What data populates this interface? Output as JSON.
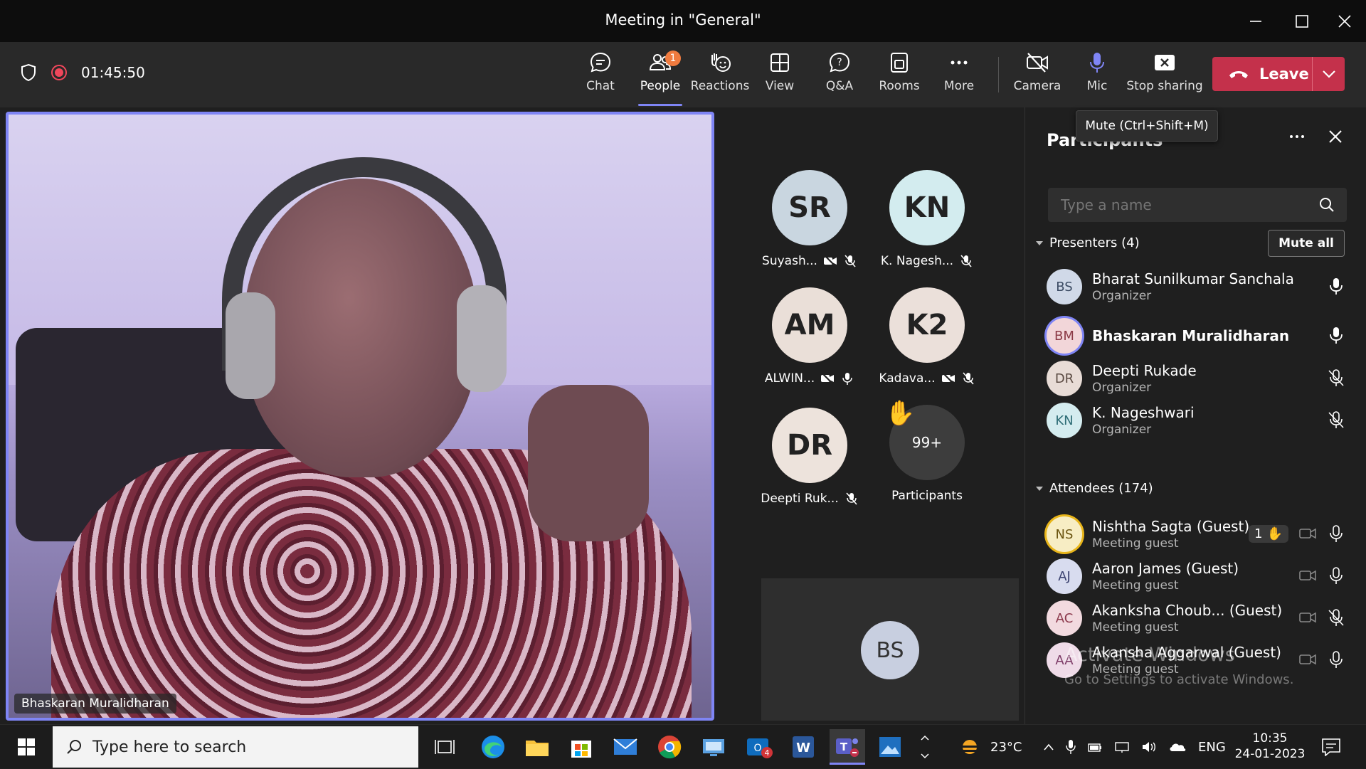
{
  "window": {
    "title": "Meeting in \"General\"",
    "controls": [
      "minimize",
      "maximize",
      "close"
    ]
  },
  "toolbar": {
    "timer": "01:45:50",
    "buttons": [
      {
        "label": "Chat",
        "icon": "chat-icon"
      },
      {
        "label": "People",
        "icon": "people-icon",
        "badge": "1"
      },
      {
        "label": "Reactions",
        "icon": "reactions-icon"
      },
      {
        "label": "View",
        "icon": "view-icon"
      },
      {
        "label": "Q&A",
        "icon": "qa-icon"
      },
      {
        "label": "Rooms",
        "icon": "rooms-icon"
      },
      {
        "label": "More",
        "icon": "more-icon"
      },
      {
        "label": "Camera",
        "icon": "camera-off-icon"
      },
      {
        "label": "Mic",
        "icon": "mic-icon"
      },
      {
        "label": "Stop sharing",
        "icon": "stop-sharing-icon"
      }
    ],
    "leave_label": "Leave",
    "tooltip": "Mute (Ctrl+Shift+M)"
  },
  "stage": {
    "main_video_name": "Bhaskaran Muralidharan",
    "tiles": [
      {
        "initials": "SR",
        "name": "Suyash...",
        "color": "#c9d6e0"
      },
      {
        "initials": "KN",
        "name": "K. Nagesh...",
        "color": "#d3ecef"
      },
      {
        "initials": "AM",
        "name": "ALWIN...",
        "color": "#eadfd8"
      },
      {
        "initials": "K2",
        "name": "Kadava...",
        "color": "#ebe0da"
      },
      {
        "initials": "DR",
        "name": "Deepti Ruk...",
        "color": "#ede3dc"
      }
    ],
    "more": {
      "count": "99+",
      "label": "Participants"
    },
    "share_tile_initials": "BS"
  },
  "panel": {
    "title": "Participants",
    "search_placeholder": "Type a name",
    "presenters_label": "Presenters (4)",
    "mute_all_label": "Mute all",
    "presenters": [
      {
        "initials": "BS",
        "name": "Bharat Sunilkumar Sanchala",
        "role": "Organizer",
        "avatar_bg": "#d0d9e8",
        "avatar_fg": "#3b4b63"
      },
      {
        "initials": "BM",
        "name": "Bhaskaran Muralidharan",
        "role": "",
        "avatar_bg": "#f2d6d9",
        "avatar_fg": "#8b3a46"
      },
      {
        "initials": "DR",
        "name": "Deepti Rukade",
        "role": "Organizer",
        "avatar_bg": "#e8dcd6",
        "avatar_fg": "#5a4a42"
      },
      {
        "initials": "KN",
        "name": "K. Nageshwari",
        "role": "Organizer",
        "avatar_bg": "#d4ecef",
        "avatar_fg": "#2e6d76"
      }
    ],
    "attendees_label": "Attendees (174)",
    "attendees": [
      {
        "initials": "NS",
        "name": "Nishtha Sagta (Guest)",
        "role": "Meeting guest",
        "avatar_bg": "#f7edc4",
        "avatar_fg": "#6b5410",
        "hand": "1"
      },
      {
        "initials": "AJ",
        "name": "Aaron James (Guest)",
        "role": "Meeting guest",
        "avatar_bg": "#d8dcef",
        "avatar_fg": "#3b4270"
      },
      {
        "initials": "AC",
        "name": "Akanksha Choub... (Guest)",
        "role": "Meeting guest",
        "avatar_bg": "#f2dadf",
        "avatar_fg": "#8c3a4d"
      },
      {
        "initials": "AA",
        "name": "Akansha Aggarwal (Guest)",
        "role": "Meeting guest",
        "avatar_bg": "#efdbe8",
        "avatar_fg": "#7c3a66"
      }
    ],
    "watermark_title": "Activate Windows",
    "watermark_sub": "Go to Settings to activate Windows."
  },
  "taskbar": {
    "search_placeholder": "Type here to search",
    "weather": "23°C",
    "language": "ENG",
    "time": "10:35",
    "date": "24-01-2023",
    "mail_badge": "4"
  }
}
